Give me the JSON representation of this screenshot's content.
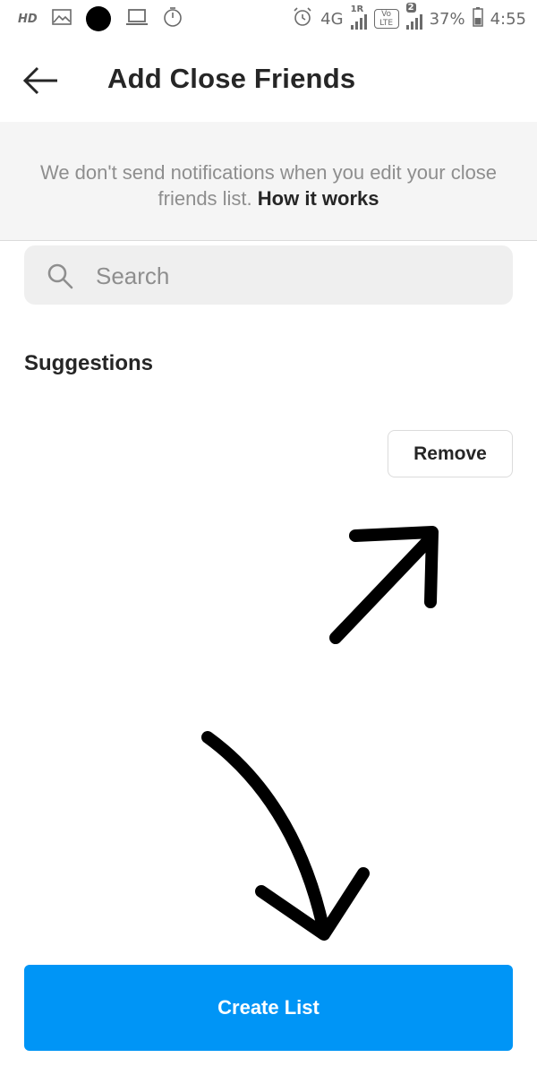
{
  "status_bar": {
    "hd_label": "HD",
    "network_label": "4G",
    "sim1_label": "1R",
    "sim2_badge": "2",
    "volte_label": "Vo LTE",
    "battery_percent": "37%",
    "time": "4:55"
  },
  "header": {
    "title": "Add Close Friends"
  },
  "notice": {
    "text": "We don't send notifications when you edit your close friends list.",
    "link": "How it works"
  },
  "search": {
    "placeholder": "Search",
    "value": ""
  },
  "suggestions": {
    "title": "Suggestions",
    "remove_label": "Remove"
  },
  "footer": {
    "create_label": "Create List"
  },
  "colors": {
    "primary_button": "#0095f6",
    "notice_background": "#f5f5f5",
    "search_background": "#efefef",
    "annotation_arrows": "#000000"
  }
}
